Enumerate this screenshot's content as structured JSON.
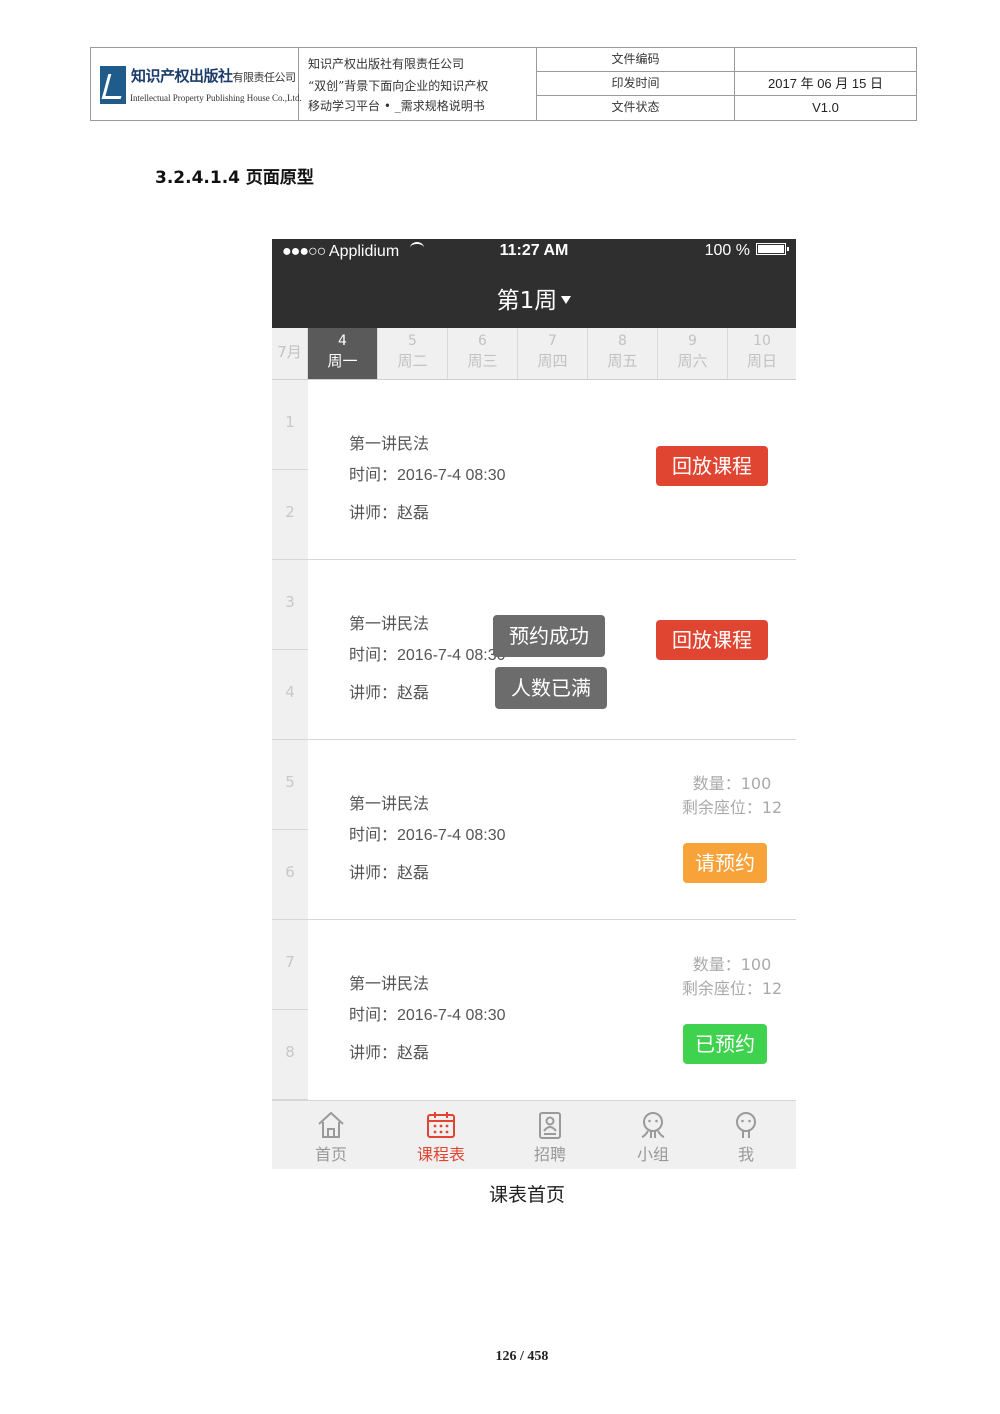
{
  "doc_header": {
    "logo_cn": "知识产权出版社",
    "logo_cn_small": "有限责任公司",
    "logo_en": "Intellectual Property Publishing House Co.,Ltd.",
    "title_lines": [
      "知识产权出版社有限责任公司",
      "“双创”背景下面向企业的知识产权",
      "移动学习平台 • _需求规格说明书"
    ],
    "labels": [
      "文件编码",
      "印发时间",
      "文件状态"
    ],
    "values": [
      "",
      "2017 年 06 月 15 日",
      "V1.0"
    ]
  },
  "section_title": "3.2.4.1.4 页面原型",
  "phone": {
    "status_bar": {
      "signal": "●●●○○",
      "carrier": "Applidium",
      "time": "11:27 AM",
      "battery": "100 %"
    },
    "week_title": "第1周",
    "month": "7月",
    "days": [
      {
        "num": "4",
        "weekday": "周一",
        "active": true
      },
      {
        "num": "5",
        "weekday": "周二",
        "active": false
      },
      {
        "num": "6",
        "weekday": "周三",
        "active": false
      },
      {
        "num": "7",
        "weekday": "周四",
        "active": false
      },
      {
        "num": "8",
        "weekday": "周五",
        "active": false
      },
      {
        "num": "9",
        "weekday": "周六",
        "active": false
      },
      {
        "num": "10",
        "weekday": "周日",
        "active": false
      }
    ],
    "periods": [
      "1",
      "2",
      "3",
      "4",
      "5",
      "6",
      "7",
      "8"
    ],
    "courses": [
      {
        "name": "第一讲民法",
        "time": "时间：2016-7-4 08:30",
        "teacher": "讲师：赵磊",
        "button": "回放课程"
      },
      {
        "name": "第一讲民法",
        "time": "时间：2016-7-4 08:30",
        "teacher": "讲师：赵磊",
        "button": "回放课程",
        "popups": [
          "预约成功",
          "人数已满"
        ]
      },
      {
        "name": "第一讲民法",
        "time": "时间：2016-7-4 08:30",
        "teacher": "讲师：赵磊",
        "button": "请预约",
        "capacity": "数量：100",
        "seats": "剩余座位：12"
      },
      {
        "name": "第一讲民法",
        "time": "时间：2016-7-4 08:30",
        "teacher": "讲师：赵磊",
        "button": "已预约",
        "capacity": "数量：100",
        "seats": "剩余座位：12"
      }
    ],
    "tabs": [
      {
        "label": "首页",
        "icon": "home-icon"
      },
      {
        "label": "课程表",
        "icon": "calendar-icon",
        "active": true
      },
      {
        "label": "招聘",
        "icon": "resume-icon"
      },
      {
        "label": "小组",
        "icon": "group-icon"
      },
      {
        "label": "我",
        "icon": "user-icon"
      }
    ],
    "colors": {
      "accent_red": "#e04532",
      "orange": "#f8a23a",
      "green": "#3fd24f",
      "dark_bar": "#2f2f2f"
    }
  },
  "caption": "课表首页",
  "page_number": "126 / 458"
}
